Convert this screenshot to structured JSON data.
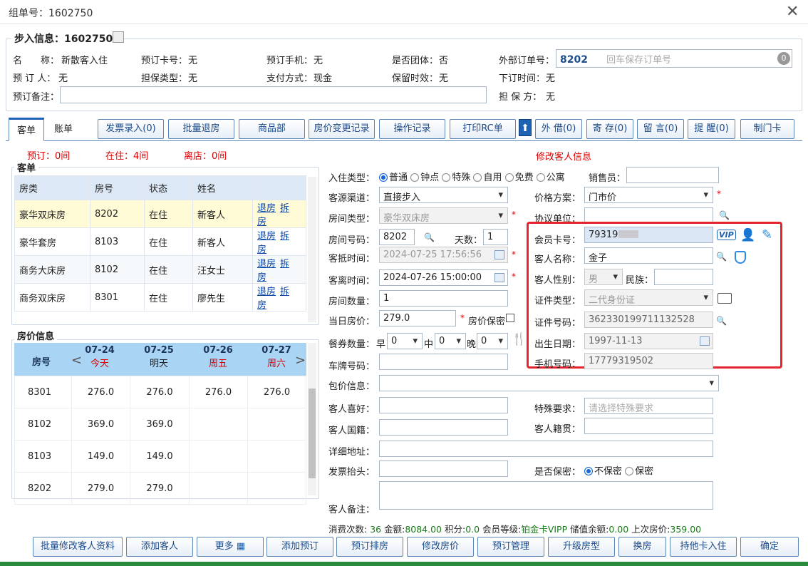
{
  "window": {
    "title": "组单号：1602750"
  },
  "info": {
    "legend": "步入信息：1602750",
    "name_label": "名　　称：",
    "name": "新散客入住",
    "card_label": "预订卡号：",
    "card": "无",
    "phone_label": "预订手机：",
    "phone": "无",
    "group_label": "是否团体：",
    "group": "否",
    "ext_order_label": "外部订单号：",
    "ext_order": "8202",
    "ext_order_placeholder": "回车保存订单号",
    "ext_badge": "0",
    "booker_label": "预 订 人：",
    "booker": "无",
    "guarantee_type_label": "担保类型：",
    "guarantee_type": "无",
    "pay_label": "支付方式：",
    "pay": "现金",
    "hold_label": "保留时效：",
    "hold": "无",
    "order_time_label": "下订时间：",
    "order_time": "无",
    "remark_label": "预订备注：",
    "guarantor_label": "担 保 方：",
    "guarantor": "无"
  },
  "tabs": {
    "guest": "客单",
    "bill": "账单"
  },
  "toolbar": [
    "发票录入(0)",
    "批量退房",
    "商品部",
    "房价变更记录",
    "操作记录",
    "打印RC单",
    "外 借(0)",
    "寄 存(0)",
    "留 言(0)",
    "提 醒(0)",
    "制门卡"
  ],
  "status": {
    "reserve": "预订：0间",
    "in": "在住：4间",
    "out": "离店：0间",
    "edit_title": "修改客人信息"
  },
  "guest_list": {
    "title": "客单",
    "headers": [
      "房类",
      "房号",
      "状态",
      "姓名"
    ],
    "rows": [
      {
        "type": "豪华双床房",
        "room": "8202",
        "status": "在住",
        "name": "新客人"
      },
      {
        "type": "豪华套房",
        "room": "8103",
        "status": "在住",
        "name": "新客人"
      },
      {
        "type": "商务大床房",
        "room": "8102",
        "status": "在住",
        "name": "汪女士"
      },
      {
        "type": "商务双床房",
        "room": "8301",
        "status": "在住",
        "name": "廖先生"
      }
    ],
    "act1": "退房",
    "act2": "拆房"
  },
  "price": {
    "title": "房价信息",
    "room_hdr": "房号",
    "dates": [
      {
        "d": "07-24",
        "w": "今天"
      },
      {
        "d": "07-25",
        "w": "明天"
      },
      {
        "d": "07-26",
        "w": "周五"
      },
      {
        "d": "07-27",
        "w": "周六"
      }
    ],
    "rows": [
      {
        "room": "8301",
        "p": [
          "276.0",
          "276.0",
          "276.0",
          "276.0"
        ]
      },
      {
        "room": "8102",
        "p": [
          "369.0",
          "369.0",
          "",
          ""
        ]
      },
      {
        "room": "8103",
        "p": [
          "149.0",
          "149.0",
          "",
          ""
        ]
      },
      {
        "room": "8202",
        "p": [
          "279.0",
          "279.0",
          "",
          ""
        ]
      }
    ]
  },
  "form": {
    "checkin_type_label": "入住类型：",
    "checkin_types": [
      "普通",
      "钟点",
      "特殊",
      "自用",
      "免费",
      "公寓"
    ],
    "sales_label": "销售员：",
    "source_label": "客源渠道：",
    "source": "直接步入",
    "price_plan_label": "价格方案：",
    "price_plan": "门市价",
    "room_type_label": "房间类型：",
    "room_type": "豪华双床房",
    "agreement_label": "协议单位：",
    "room_no_label": "房间号码：",
    "room_no": "8202",
    "days_label": "天数：",
    "days": "1",
    "member_label": "会员卡号：",
    "member": "79319",
    "arrive_label": "客抵时间：",
    "arrive": "2024-07-25 17:56:56",
    "guest_name_label": "客人名称：",
    "guest_name": "金子",
    "depart_label": "客离时间：",
    "depart": "2024-07-26 15:00:00",
    "gender_label": "客人性别：",
    "gender": "男",
    "nation_label": "民族：",
    "room_count_label": "房间数量：",
    "room_count": "1",
    "id_type_label": "证件类型：",
    "id_type": "二代身份证",
    "day_price_label": "当日房价：",
    "day_price": "279.0",
    "price_secret_label": "房价保密",
    "id_no_label": "证件号码：",
    "id_no": "362330199711132528",
    "meal_label": "餐券数量：",
    "meal_b": "早",
    "meal_l": "中",
    "meal_d": "晚",
    "meal_vals": [
      "0",
      "0",
      "0"
    ],
    "birth_label": "出生日期：",
    "birth": "1997-11-13",
    "plate_label": "车牌号码：",
    "mobile_label": "手机号码：",
    "mobile": "17779319502",
    "package_label": "包价信息：",
    "hobby_label": "客人喜好：",
    "special_label": "特殊要求：",
    "special_placeholder": "请选择特殊要求",
    "nationality_label": "客人国籍：",
    "native_label": "客人籍贯：",
    "address_label": "详细地址：",
    "invoice_label": "发票抬头：",
    "secret_label": "是否保密：",
    "secret_no": "不保密",
    "secret_yes": "保密",
    "remark_label": "客人备注："
  },
  "summary": {
    "l1": "消费次数:",
    "v1": "36",
    "l2": "金额:",
    "v2": "8084.00",
    "l3": "积分:",
    "v3": "0.0",
    "l4": "会员等级:",
    "v4": "铂金卡VIPP",
    "l5": "储值余额:",
    "v5": "0.00",
    "l6": "上次房价:",
    "v6": "359.00"
  },
  "bottom": [
    "批量修改客人资料",
    "添加客人",
    "更多",
    "添加预订",
    "预订排房",
    "修改房价",
    "预订管理",
    "升级房型",
    "换房",
    "持他卡入住",
    "确定"
  ],
  "vip": "VIP"
}
